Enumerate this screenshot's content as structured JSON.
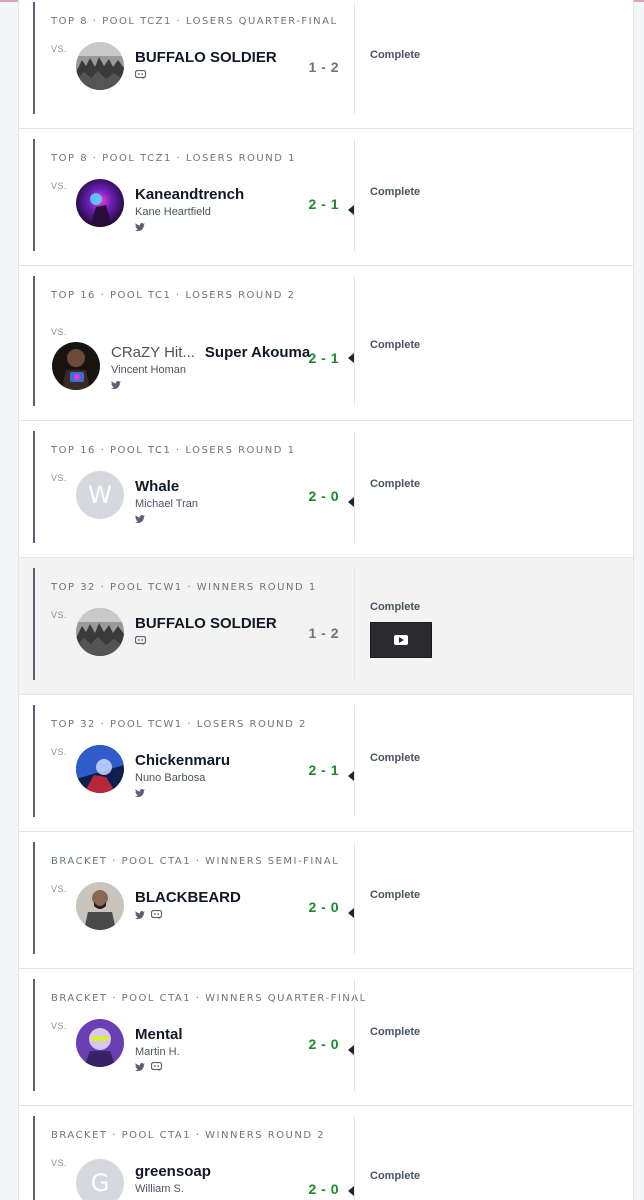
{
  "matches": [
    {
      "round": "TOP 8 · POOL TCZ1 · LOSERS QUARTER-FINAL",
      "vs": "VS.",
      "opponent": {
        "name": "BUFFALO SOLDIER",
        "socials": [
          "discord-icon"
        ]
      },
      "score": "1 - 2",
      "result": "loss",
      "status": "Complete"
    },
    {
      "round": "TOP 8 · POOL TCZ1 · LOSERS ROUND 1",
      "vs": "VS.",
      "opponent": {
        "name": "Kaneandtrench",
        "real_name": "Kane Heartfield",
        "socials": [
          "twitter-icon"
        ]
      },
      "score": "2 - 1",
      "result": "win",
      "status": "Complete"
    },
    {
      "round": "TOP 16 · POOL TC1 · LOSERS ROUND 2",
      "vs": "VS.",
      "opponent": {
        "team": "CRaZY Hit...",
        "name": "Super Akouma",
        "real_name": "Vincent Homan",
        "socials": [
          "twitter-icon"
        ]
      },
      "score": "2 - 1",
      "result": "win",
      "status": "Complete"
    },
    {
      "round": "TOP 16 · POOL TC1 · LOSERS ROUND 1",
      "vs": "VS.",
      "opponent": {
        "avatar_letter": "W",
        "name": "Whale",
        "real_name": "Michael Tran",
        "socials": [
          "twitter-icon"
        ]
      },
      "score": "2 - 0",
      "result": "win",
      "status": "Complete"
    },
    {
      "round": "TOP 32 · POOL TCW1 · WINNERS ROUND 1",
      "vs": "VS.",
      "opponent": {
        "name": "BUFFALO SOLDIER",
        "socials": [
          "discord-icon"
        ]
      },
      "score": "1 - 2",
      "result": "loss",
      "status": "Complete",
      "has_video": true
    },
    {
      "round": "TOP 32 · POOL TCW1 · LOSERS ROUND 2",
      "vs": "VS.",
      "opponent": {
        "name": "Chickenmaru",
        "real_name": "Nuno Barbosa",
        "socials": [
          "twitter-icon"
        ]
      },
      "score": "2 - 1",
      "result": "win",
      "status": "Complete"
    },
    {
      "round": "BRACKET · POOL CTA1 · WINNERS SEMI-FINAL",
      "vs": "VS.",
      "opponent": {
        "name": "BLACKBEARD",
        "socials": [
          "twitter-icon",
          "discord-icon"
        ]
      },
      "score": "2 - 0",
      "result": "win",
      "status": "Complete"
    },
    {
      "round": "BRACKET · POOL CTA1 · WINNERS QUARTER-FINAL",
      "vs": "VS.",
      "opponent": {
        "name": "Mental",
        "real_name": "Martin H.",
        "socials": [
          "twitter-icon",
          "discord-icon"
        ]
      },
      "score": "2 - 0",
      "result": "win",
      "status": "Complete"
    },
    {
      "round": "BRACKET · POOL CTA1 · WINNERS ROUND 2",
      "vs": "VS.",
      "opponent": {
        "avatar_letter": "G",
        "name": "greensoap",
        "real_name": "William S.",
        "socials": []
      },
      "score": "2 - 0",
      "result": "win",
      "status": "Complete"
    }
  ],
  "colors": {
    "win": "#1b8a2b",
    "loss": "#6e7380",
    "accent_bar": "#5b6270"
  }
}
